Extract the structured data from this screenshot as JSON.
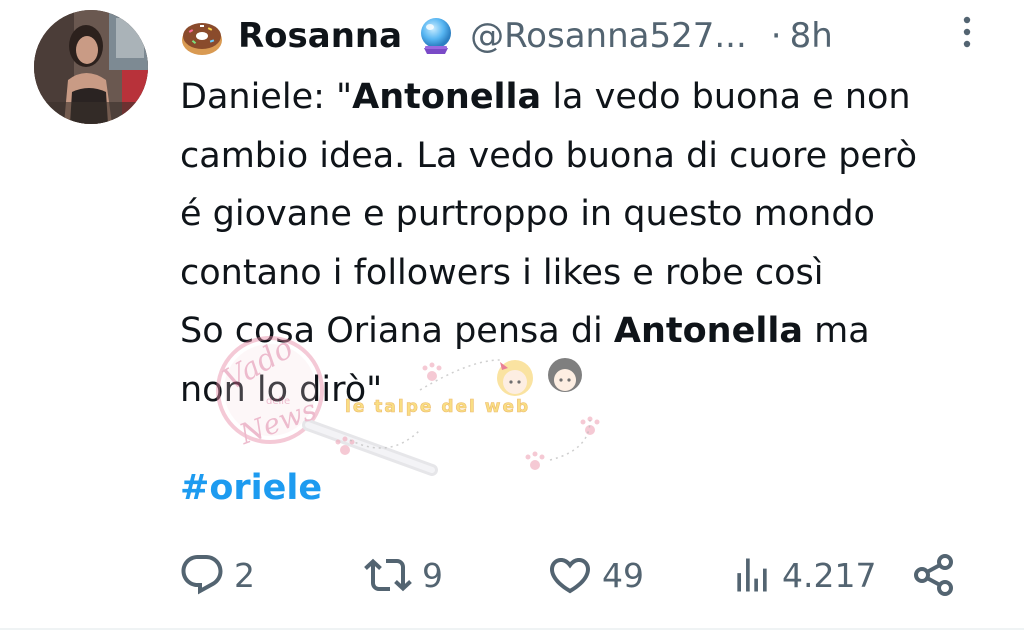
{
  "user": {
    "display_name": "Rosanna",
    "handle": "@Rosanna527...",
    "separator": "·",
    "time": "8h"
  },
  "icons": {
    "name_emoji": "donut-icon",
    "name_badge": "crystal-ball-icon",
    "more": "more-vertical-icon"
  },
  "tweet": {
    "lines": [
      [
        "Daniele: \"",
        "Antonella",
        " la vedo buona e non"
      ],
      [
        "cambio idea. La vedo buona di cuore però"
      ],
      [
        "é giovane e purtroppo in questo mondo"
      ],
      [
        "contano i followers i likes e robe così"
      ],
      [
        "So cosa Oriana pensa di ",
        "Antonella",
        " ma"
      ],
      [
        "non lo dirò\""
      ]
    ],
    "hashtag": "#oriele"
  },
  "watermark": {
    "left_text": "Vado delle News",
    "right_text": "le talpe del web"
  },
  "actions": {
    "replies": "2",
    "reposts": "9",
    "likes": "49",
    "views": "4.217"
  },
  "colors": {
    "text": "#0f1419",
    "secondary": "#536471",
    "link": "#1d9bf0"
  }
}
